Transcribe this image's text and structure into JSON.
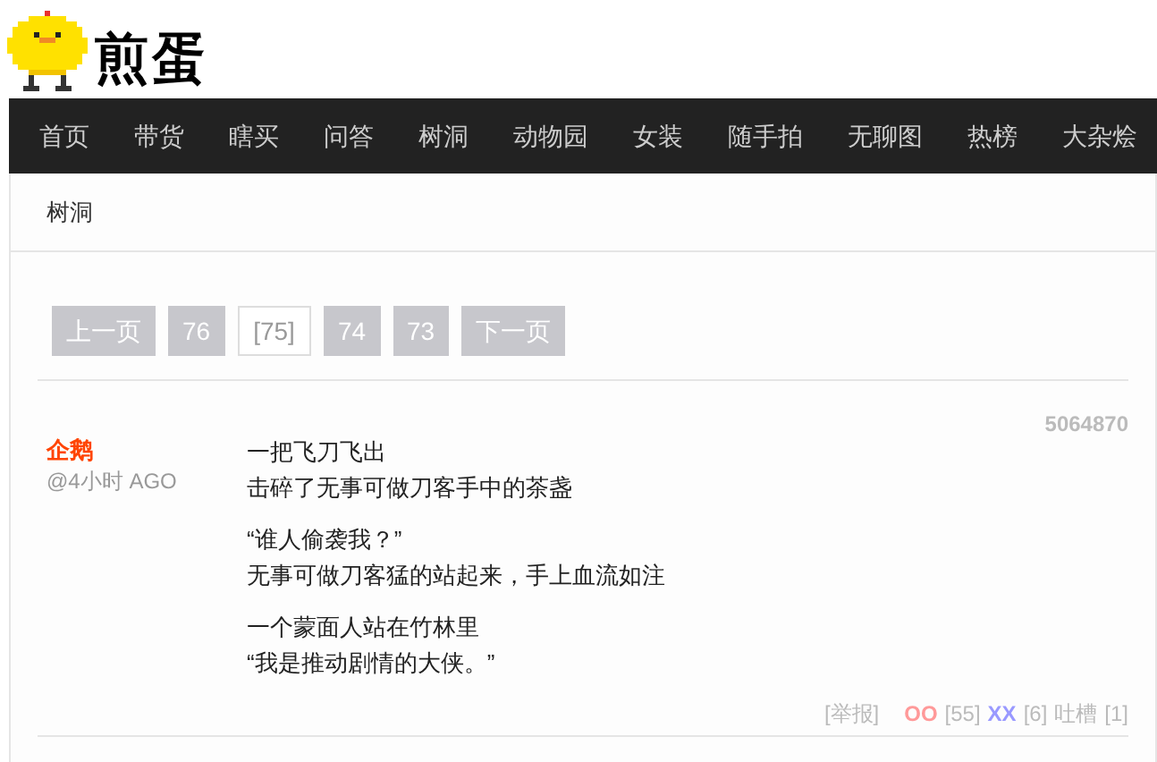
{
  "logo": {
    "text": "煎蛋"
  },
  "nav": [
    "首页",
    "带货",
    "瞎买",
    "问答",
    "树洞",
    "动物园",
    "女装",
    "随手拍",
    "无聊图",
    "热榜",
    "大杂烩"
  ],
  "breadcrumb": "树洞",
  "pagination": [
    {
      "label": "上一页",
      "selected": false
    },
    {
      "label": "76",
      "selected": false
    },
    {
      "label": "[75]",
      "selected": true
    },
    {
      "label": "74",
      "selected": false
    },
    {
      "label": "73",
      "selected": false
    },
    {
      "label": "下一页",
      "selected": false
    }
  ],
  "post": {
    "author": "企鹅",
    "time": "@4小时 AGO",
    "id": "5064870",
    "paragraphs": [
      [
        "一把飞刀飞出",
        "击碎了无事可做刀客手中的茶盏"
      ],
      [
        "“谁人偷袭我？”",
        "无事可做刀客猛的站起来，手上血流如注"
      ],
      [
        "一个蒙面人站在竹林里",
        "“我是推动剧情的大侠。”"
      ]
    ],
    "footer": {
      "report": "[举报]",
      "oo": "OO",
      "oo_count": "[55]",
      "xx": "XX",
      "xx_count": "[6]",
      "comments": "吐槽",
      "comments_count": "[1]"
    }
  }
}
